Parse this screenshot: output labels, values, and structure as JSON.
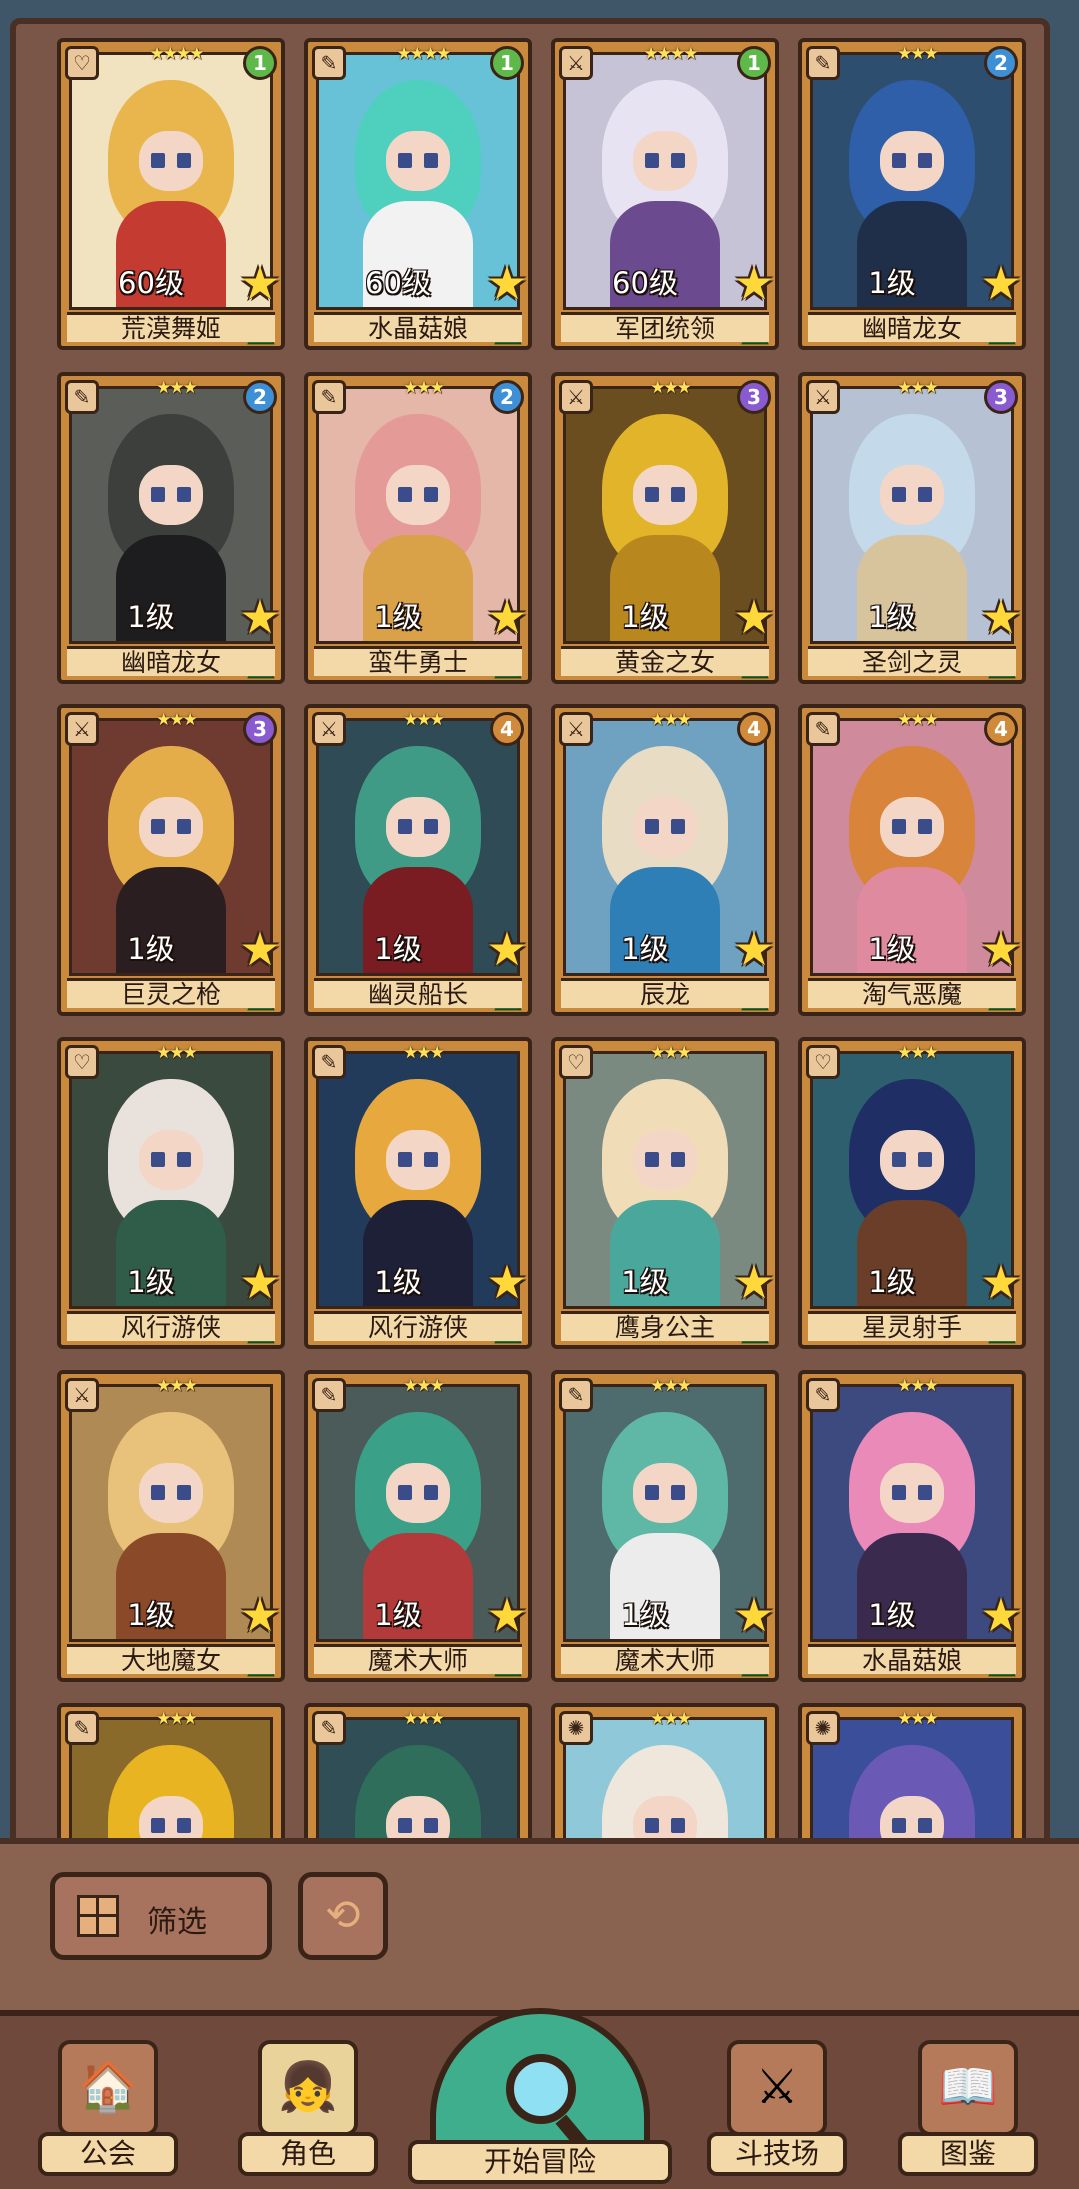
{
  "colors": {
    "tier_green": "#5fb84a",
    "tier_blue": "#3d8fd6",
    "tier_purple": "#8a5ad0",
    "tier_orange": "#d08a3a",
    "card_border": "#c98a3e"
  },
  "cards": [
    {
      "name": "荒漠舞姬",
      "level": "60级",
      "tier": "1",
      "tier_color": "#5fb84a",
      "stars": "★★★★",
      "type_icon": "♡",
      "hair": "#e9b54d",
      "outfit": "#c43b32",
      "bg": "#f1e3c0"
    },
    {
      "name": "水晶菇娘",
      "level": "60级",
      "tier": "1",
      "tier_color": "#5fb84a",
      "stars": "★★★★",
      "type_icon": "✎",
      "hair": "#4fd0bf",
      "outfit": "#f2f2f2",
      "bg": "#67c2d8"
    },
    {
      "name": "军团统领",
      "level": "60级",
      "tier": "1",
      "tier_color": "#5fb84a",
      "stars": "★★★★",
      "type_icon": "⚔",
      "hair": "#e7e3f2",
      "outfit": "#6b4a90",
      "bg": "#c7c3d6"
    },
    {
      "name": "幽暗龙女",
      "level": "1级",
      "tier": "2",
      "tier_color": "#3d8fd6",
      "stars": "★★★",
      "type_icon": "✎",
      "hair": "#2f5fa8",
      "outfit": "#1f2f4a",
      "bg": "#2d4e6e"
    },
    {
      "name": "幽暗龙女",
      "level": "1级",
      "tier": "2",
      "tier_color": "#3d8fd6",
      "stars": "★★★",
      "type_icon": "✎",
      "hair": "#3c3f3c",
      "outfit": "#1d1d1f",
      "bg": "#5b5e58"
    },
    {
      "name": "蛮牛勇士",
      "level": "1级",
      "tier": "2",
      "tier_color": "#3d8fd6",
      "stars": "★★★",
      "type_icon": "✎",
      "hair": "#e49a96",
      "outfit": "#d9a148",
      "bg": "#e5b7a8"
    },
    {
      "name": "黄金之女",
      "level": "1级",
      "tier": "3",
      "tier_color": "#8a5ad0",
      "stars": "★★★",
      "type_icon": "⚔",
      "hair": "#e2b42a",
      "outfit": "#b8871e",
      "bg": "#6a4e20"
    },
    {
      "name": "圣剑之灵",
      "level": "1级",
      "tier": "3",
      "tier_color": "#8a5ad0",
      "stars": "★★★",
      "type_icon": "⚔",
      "hair": "#c4d9ea",
      "outfit": "#d8c49c",
      "bg": "#b6c2d4"
    },
    {
      "name": "巨灵之枪",
      "level": "1级",
      "tier": "3",
      "tier_color": "#8a5ad0",
      "stars": "★★★",
      "type_icon": "⚔",
      "hair": "#e5ad4a",
      "outfit": "#2b1e20",
      "bg": "#6f3a30"
    },
    {
      "name": "幽灵船长",
      "level": "1级",
      "tier": "4",
      "tier_color": "#d08a3a",
      "stars": "★★★",
      "type_icon": "⚔",
      "hair": "#3f9a86",
      "outfit": "#7a1d22",
      "bg": "#2f4b56"
    },
    {
      "name": "辰龙",
      "level": "1级",
      "tier": "4",
      "tier_color": "#d08a3a",
      "stars": "★★★",
      "type_icon": "⚔",
      "hair": "#e8dcc4",
      "outfit": "#2e7fb6",
      "bg": "#6fa2c0"
    },
    {
      "name": "淘气恶魔",
      "level": "1级",
      "tier": "4",
      "tier_color": "#d08a3a",
      "stars": "★★★",
      "type_icon": "✎",
      "hair": "#d8843a",
      "outfit": "#e08aa0",
      "bg": "#cf8b9c"
    },
    {
      "name": "风行游侠",
      "level": "1级",
      "tier": "",
      "tier_color": "",
      "stars": "★★★",
      "type_icon": "♡",
      "hair": "#e9e2dc",
      "outfit": "#2f5d4a",
      "bg": "#3b4a3f"
    },
    {
      "name": "风行游侠",
      "level": "1级",
      "tier": "",
      "tier_color": "",
      "stars": "★★★",
      "type_icon": "✎",
      "hair": "#e7a83e",
      "outfit": "#1e2038",
      "bg": "#233b5a"
    },
    {
      "name": "鹰身公主",
      "level": "1级",
      "tier": "",
      "tier_color": "",
      "stars": "★★★",
      "type_icon": "♡",
      "hair": "#f1dcb8",
      "outfit": "#4aa79b",
      "bg": "#7a8a80"
    },
    {
      "name": "星灵射手",
      "level": "1级",
      "tier": "",
      "tier_color": "",
      "stars": "★★★",
      "type_icon": "♡",
      "hair": "#1f2f66",
      "outfit": "#6b3e2a",
      "bg": "#2e5f6e"
    },
    {
      "name": "大地魔女",
      "level": "1级",
      "tier": "",
      "tier_color": "",
      "stars": "★★★",
      "type_icon": "⚔",
      "hair": "#e8c27a",
      "outfit": "#8a4a2a",
      "bg": "#b08a54"
    },
    {
      "name": "魔术大师",
      "level": "1级",
      "tier": "",
      "tier_color": "",
      "stars": "★★★",
      "type_icon": "✎",
      "hair": "#3aa088",
      "outfit": "#b33a3a",
      "bg": "#4a5b5a"
    },
    {
      "name": "魔术大师",
      "level": "1级",
      "tier": "",
      "tier_color": "",
      "stars": "★★★",
      "type_icon": "✎",
      "hair": "#5fb8a6",
      "outfit": "#ececec",
      "bg": "#4e6b6e"
    },
    {
      "name": "水晶菇娘",
      "level": "1级",
      "tier": "",
      "tier_color": "",
      "stars": "★★★",
      "type_icon": "✎",
      "hair": "#ea8ab8",
      "outfit": "#3a2a4e",
      "bg": "#3c4a80"
    },
    {
      "name": "",
      "level": "",
      "tier": "",
      "tier_color": "",
      "stars": "★★★",
      "type_icon": "✎",
      "hair": "#e8b422",
      "outfit": "#e8b422",
      "bg": "#8a6a2a"
    },
    {
      "name": "",
      "level": "",
      "tier": "",
      "tier_color": "",
      "stars": "★★★",
      "type_icon": "✎",
      "hair": "#2f6e5a",
      "outfit": "#2f6e5a",
      "bg": "#2f4e55"
    },
    {
      "name": "",
      "level": "",
      "tier": "",
      "tier_color": "",
      "stars": "★★★",
      "type_icon": "✺",
      "hair": "#efe6dc",
      "outfit": "#efe6dc",
      "bg": "#8fc8d8"
    },
    {
      "name": "",
      "level": "",
      "tier": "",
      "tier_color": "",
      "stars": "★★★",
      "type_icon": "✺",
      "hair": "#6a5ab6",
      "outfit": "#6a5ab6",
      "bg": "#3a4e9a"
    }
  ],
  "controls": {
    "filter_label": "筛选",
    "refresh_icon": "⟲"
  },
  "nav": {
    "guild": {
      "label": "公会",
      "icon": "🏠"
    },
    "role": {
      "label": "角色",
      "icon": "👧"
    },
    "adventure": {
      "label": "开始冒险"
    },
    "arena": {
      "label": "斗技场",
      "icon": "⚔"
    },
    "codex": {
      "label": "图鉴",
      "icon": "📖"
    }
  }
}
